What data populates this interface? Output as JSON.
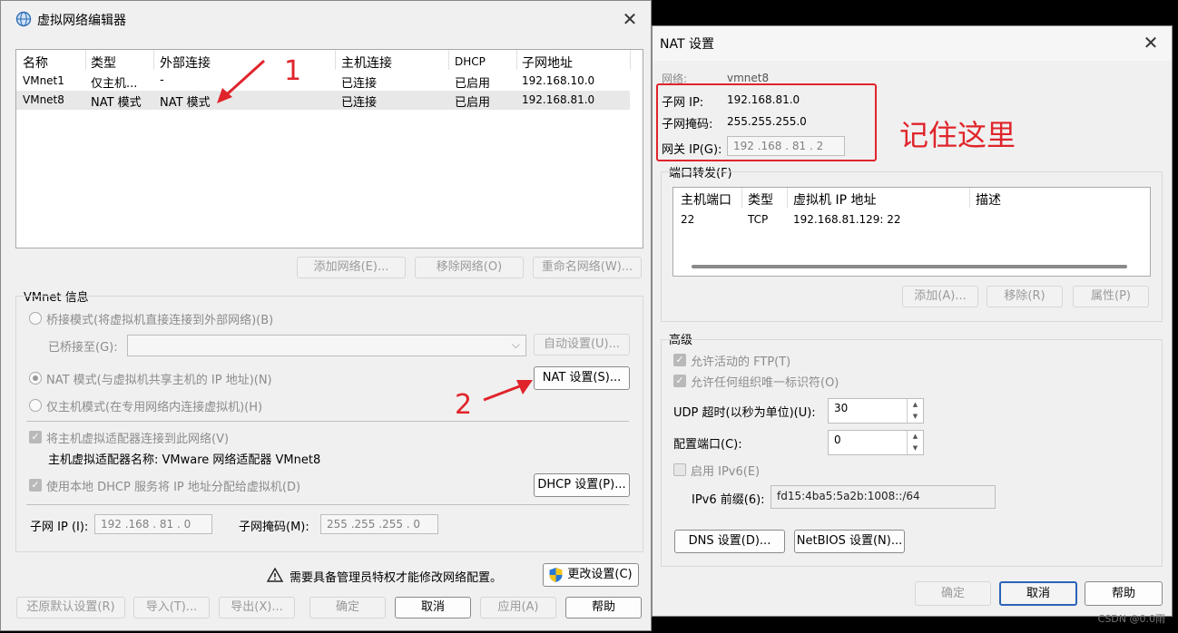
{
  "left": {
    "title": "虚拟网络编辑器",
    "columns": [
      "名称",
      "类型",
      "外部连接",
      "主机连接",
      "DHCP",
      "子网地址"
    ],
    "rows": [
      [
        "VMnet1",
        "仅主机...",
        "-",
        "已连接",
        "已启用",
        "192.168.10.0"
      ],
      [
        "VMnet8",
        "NAT 模式",
        "NAT 模式",
        "已连接",
        "已启用",
        "192.168.81.0"
      ]
    ],
    "net_buttons": [
      "添加网络(E)...",
      "移除网络(O)",
      "重命名网络(W)..."
    ],
    "vmnet_info_label": "VMnet 信息",
    "bridge_radio": "桥接模式(将虚拟机直接连接到外部网络)(B)",
    "bridged_to_label": "已桥接至(G):",
    "auto_settings": "自动设置(U)...",
    "nat_radio": "NAT 模式(与虚拟机共享主机的 IP 地址)(N)",
    "nat_settings": "NAT 设置(S)...",
    "hostonly_radio": "仅主机模式(在专用网络内连接虚拟机)(H)",
    "connect_adapter": "将主机虚拟适配器连接到此网络(V)",
    "adapter_name": "主机虚拟适配器名称: VMware 网络适配器 VMnet8",
    "use_dhcp": "使用本地 DHCP 服务将 IP 地址分配给虚拟机(D)",
    "dhcp_settings": "DHCP 设置(P)...",
    "subnet_ip_label": "子网 IP (I):",
    "subnet_ip": "192 .168 . 81 . 0",
    "subnet_mask_label": "子网掩码(M):",
    "subnet_mask": "255 .255 .255 . 0",
    "admin_warning": "需要具备管理员特权才能修改网络配置。",
    "change_settings": "更改设置(C)",
    "bottom_buttons": [
      "还原默认设置(R)",
      "导入(T)...",
      "导出(X)...",
      "确定",
      "取消",
      "应用(A)",
      "帮助"
    ]
  },
  "annotations": {
    "one": "1",
    "two": "2",
    "remember": "记住这里"
  },
  "nat": {
    "title": "NAT 设置",
    "network_label": "网络:",
    "network_value": "vmnet8",
    "subnet_ip_label": "子网 IP:",
    "subnet_ip": "192.168.81.0",
    "subnet_mask_label": "子网掩码:",
    "subnet_mask": "255.255.255.0",
    "gateway_label": "网关 IP(G):",
    "gateway": "192 .168 . 81 . 2",
    "port_forward_label": "端口转发(F)",
    "pf_columns": [
      "主机端口",
      "类型",
      "虚拟机 IP 地址",
      "描述"
    ],
    "pf_rows": [
      [
        "22",
        "TCP",
        "192.168.81.129: 22",
        ""
      ]
    ],
    "pf_buttons": [
      "添加(A)...",
      "移除(R)",
      "属性(P)"
    ],
    "advanced_label": "高级",
    "allow_ftp": "允许活动的 FTP(T)",
    "allow_oui": "允许任何组织唯一标识符(O)",
    "udp_timeout_label": "UDP 超时(以秒为单位)(U):",
    "udp_timeout": "30",
    "config_port_label": "配置端口(C):",
    "config_port": "0",
    "enable_ipv6": "启用 IPv6(E)",
    "ipv6_prefix_label": "IPv6 前缀(6):",
    "ipv6_prefix": "fd15:4ba5:5a2b:1008::/64",
    "dns_settings": "DNS 设置(D)...",
    "netbios_settings": "NetBIOS 设置(N)...",
    "ok": "确定",
    "cancel": "取消",
    "help": "帮助"
  },
  "watermark": "CSDN @0.0雨",
  "colors": {
    "annotation_red": "#e0242b",
    "accent_blue": "#2b63b8"
  }
}
